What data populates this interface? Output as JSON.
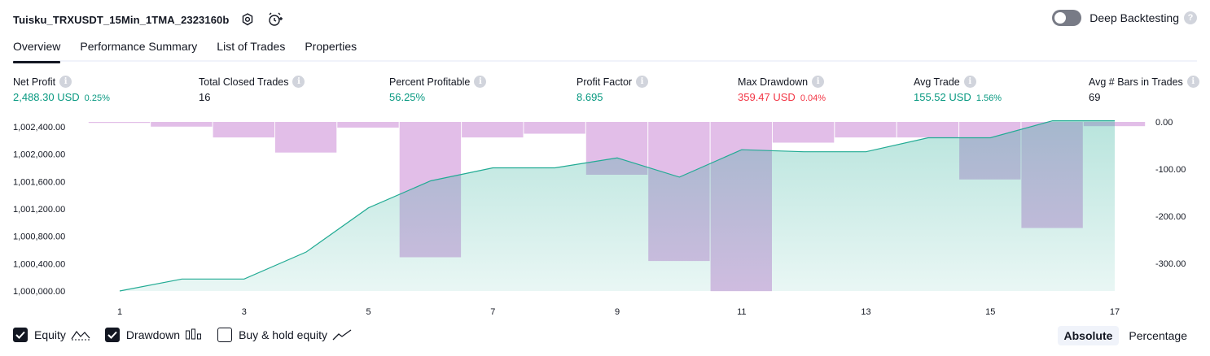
{
  "header": {
    "strategy_name": "Tuisku_TRXUSDT_15Min_1TMA_2323160b",
    "deep_backtesting_label": "Deep Backtesting",
    "help_glyph": "?"
  },
  "tabs": [
    {
      "label": "Overview",
      "active": true
    },
    {
      "label": "Performance Summary",
      "active": false
    },
    {
      "label": "List of Trades",
      "active": false
    },
    {
      "label": "Properties",
      "active": false
    }
  ],
  "stats": [
    {
      "label": "Net Profit",
      "value": "2,488.30 USD",
      "sub": "0.25%",
      "tone": "pos"
    },
    {
      "label": "Total Closed Trades",
      "value": "16",
      "sub": "",
      "tone": "neutral"
    },
    {
      "label": "Percent Profitable",
      "value": "56.25%",
      "sub": "",
      "tone": "pos"
    },
    {
      "label": "Profit Factor",
      "value": "8.695",
      "sub": "",
      "tone": "pos"
    },
    {
      "label": "Max Drawdown",
      "value": "359.47 USD",
      "sub": "0.04%",
      "tone": "neg"
    },
    {
      "label": "Avg Trade",
      "value": "155.52 USD",
      "sub": "1.56%",
      "tone": "pos"
    },
    {
      "label": "Avg # Bars in Trades",
      "value": "69",
      "sub": "",
      "tone": "neutral"
    }
  ],
  "info_glyph": "i",
  "chart_data": {
    "type": "area",
    "x": [
      1,
      2,
      3,
      4,
      5,
      6,
      7,
      8,
      9,
      10,
      11,
      12,
      13,
      14,
      15,
      16,
      17
    ],
    "x_ticks": [
      "1",
      "3",
      "5",
      "7",
      "9",
      "11",
      "13",
      "15",
      "17"
    ],
    "left_axis": {
      "ticks": [
        "1,000,000.00",
        "1,000,400.00",
        "1,000,800.00",
        "1,001,200.00",
        "1,001,600.00",
        "1,002,000.00",
        "1,002,400.00"
      ],
      "range": [
        1000000,
        1002500
      ]
    },
    "right_axis": {
      "ticks": [
        "0.00",
        "-100.00",
        "-200.00",
        "-300.00"
      ],
      "range": [
        0,
        -360
      ]
    },
    "series": [
      {
        "name": "Equity",
        "axis": "left",
        "values": [
          1000000,
          1000175,
          1000175,
          1000570,
          1001215,
          1001610,
          1001800,
          1001800,
          1001945,
          1001665,
          1002065,
          1002035,
          1002035,
          1002240,
          1002240,
          1002488,
          1002488
        ],
        "color": "#22ab94"
      },
      {
        "name": "Drawdown",
        "axis": "right",
        "values": [
          -2,
          -10,
          -33,
          -65,
          -12,
          -287,
          -33,
          -25,
          -112,
          -295,
          -359,
          -44,
          -33,
          -33,
          -122,
          -225,
          -9
        ],
        "color": "#ce93d8"
      }
    ]
  },
  "legend": [
    {
      "label": "Equity",
      "checked": true,
      "glyph": "equity-icon"
    },
    {
      "label": "Drawdown",
      "checked": true,
      "glyph": "drawdown-icon"
    },
    {
      "label": "Buy & hold equity",
      "checked": false,
      "glyph": "buy-hold-icon"
    }
  ],
  "mode": {
    "absolute_label": "Absolute",
    "percentage_label": "Percentage",
    "selected": "Absolute"
  }
}
